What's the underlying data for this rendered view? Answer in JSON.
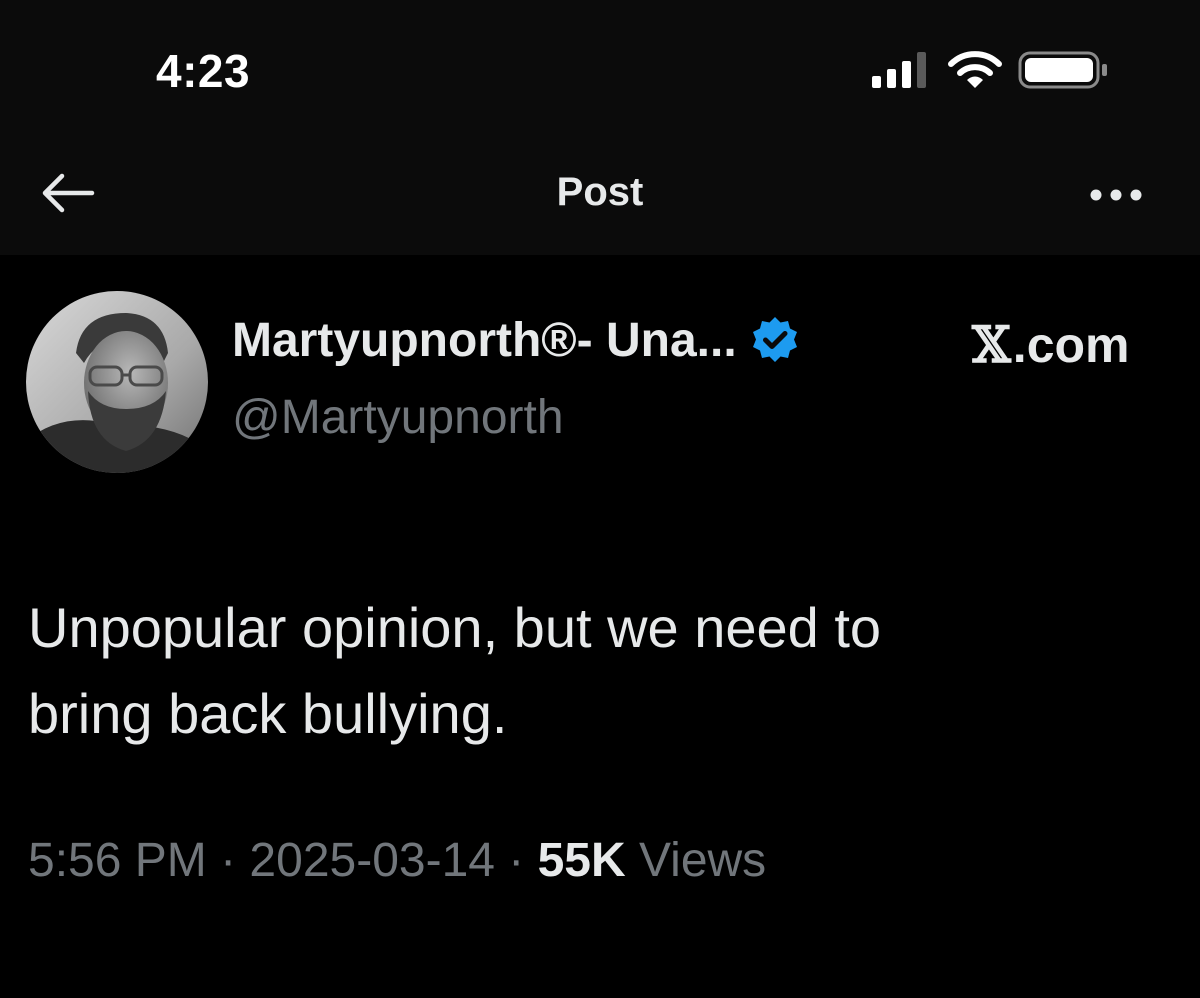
{
  "status_bar": {
    "time": "4:23",
    "icons": [
      "cellular-signal-icon",
      "wifi-icon",
      "battery-icon"
    ]
  },
  "nav": {
    "title": "Post",
    "back_icon": "arrow-left-icon",
    "more_icon": "ellipsis-icon"
  },
  "post": {
    "author": {
      "display_name": "Martyupnorth®- Una...",
      "handle": "@Martyupnorth",
      "verified": true
    },
    "source": {
      "x_glyph": "𝕏",
      "suffix": ".com"
    },
    "text_line1": "Unpopular opinion, but we need to",
    "text_line2": "bring back bullying.",
    "time": "5:56 PM",
    "separator": " · ",
    "date": "2025-03-14",
    "views_count": "55K",
    "views_label": " Views"
  },
  "colors": {
    "background": "#000000",
    "header_background": "#0b0b0b",
    "primary_text": "#e7e9ea",
    "secondary_text": "#71767b",
    "verified_blue": "#1d9bf0"
  }
}
